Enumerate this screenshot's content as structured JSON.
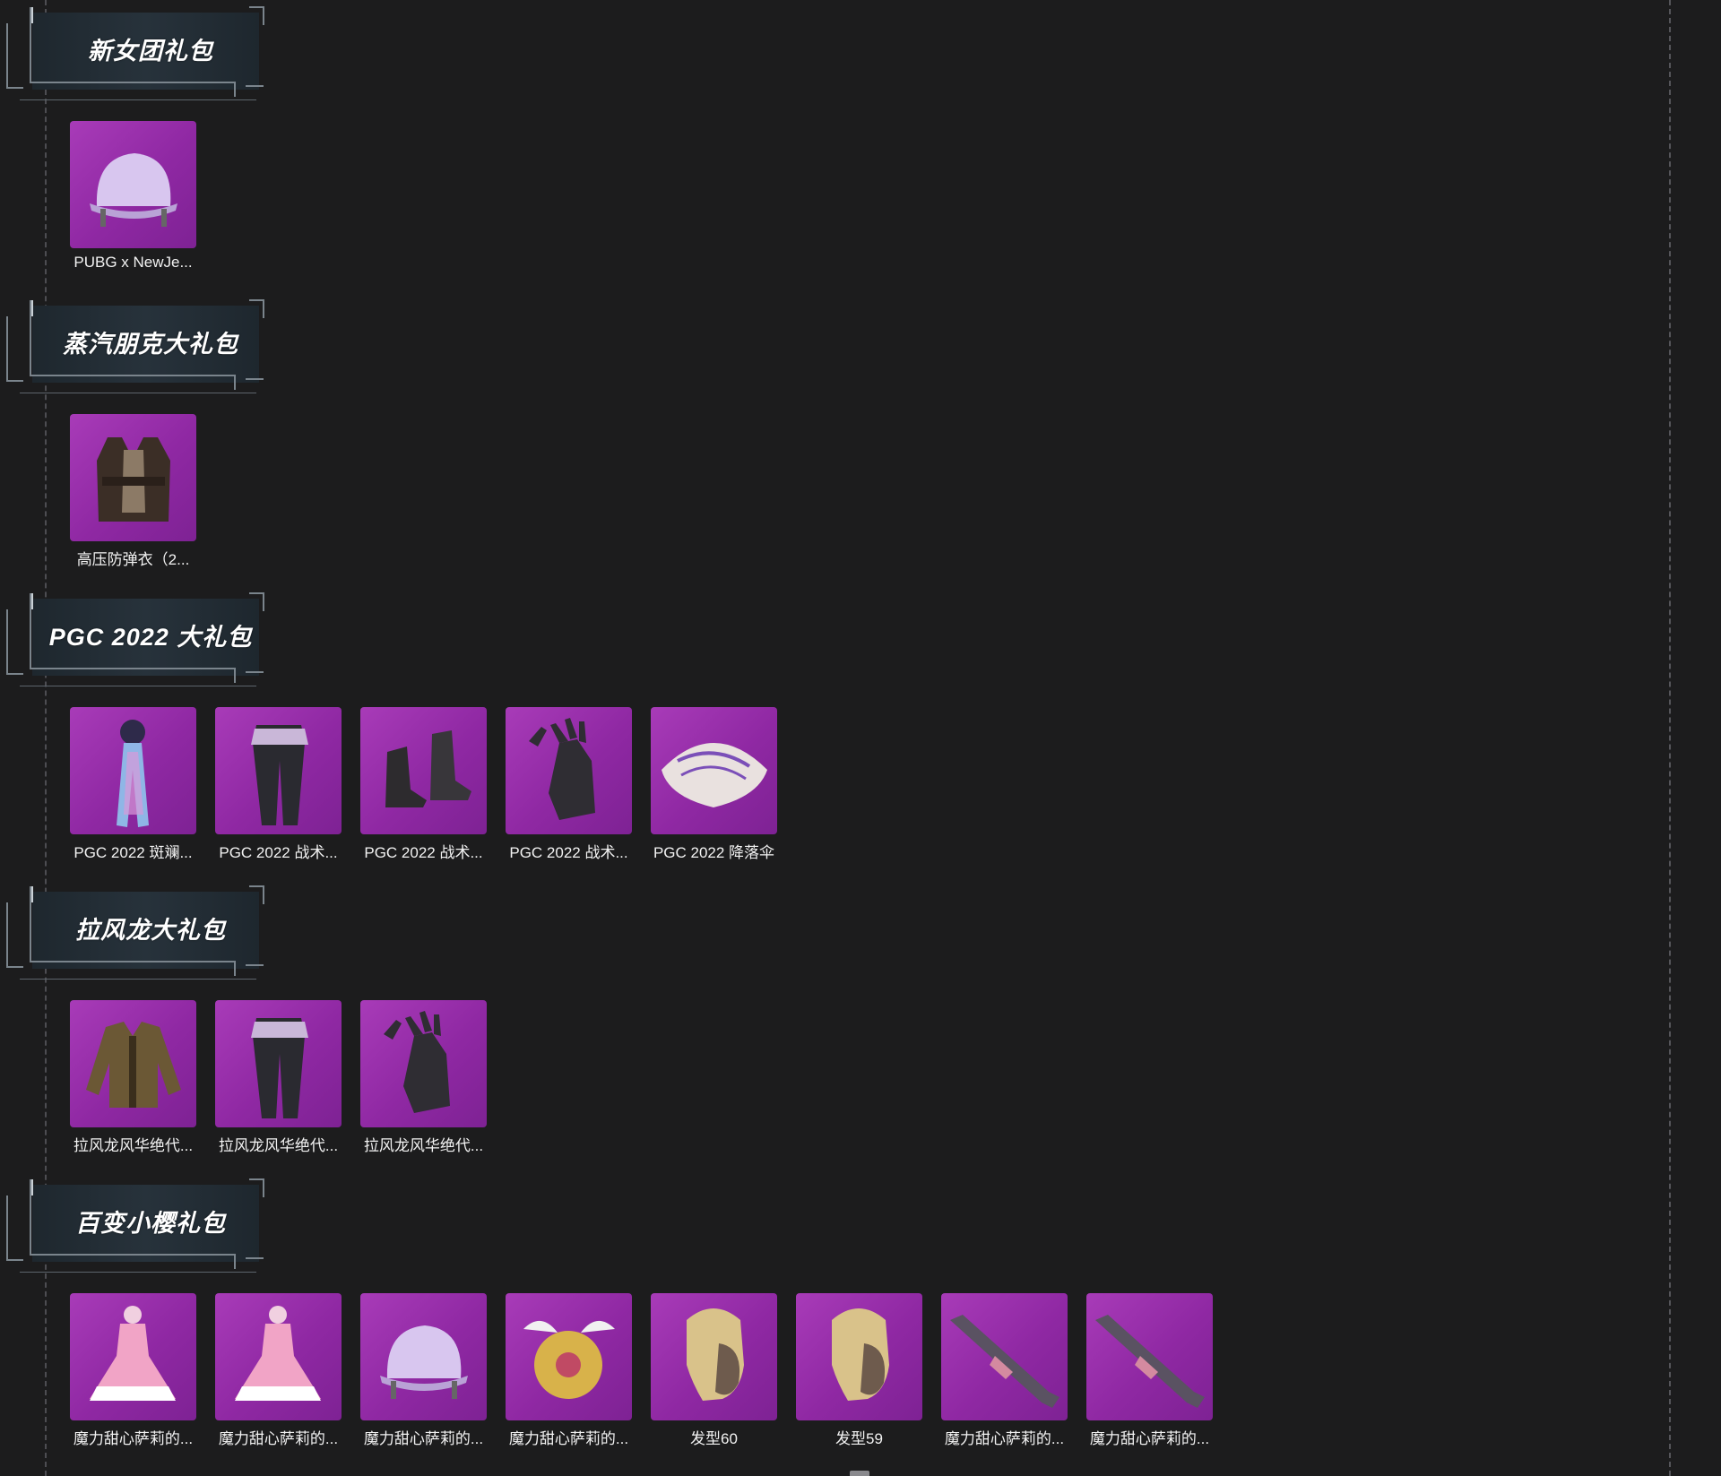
{
  "sections": [
    {
      "title": "新女团礼包",
      "items": [
        {
          "label": "PUBG x NewJe...",
          "icon": "helmet-icon"
        }
      ]
    },
    {
      "title": "蒸汽朋克大礼包",
      "items": [
        {
          "label": "高压防弹衣（2...",
          "icon": "vest-icon"
        }
      ]
    },
    {
      "title": "PGC 2022 大礼包",
      "items": [
        {
          "label": "PGC 2022 斑斓...",
          "icon": "scarf-icon"
        },
        {
          "label": "PGC 2022 战术...",
          "icon": "pants-icon"
        },
        {
          "label": "PGC 2022 战术...",
          "icon": "boots-icon"
        },
        {
          "label": "PGC 2022 战术...",
          "icon": "gloves-icon"
        },
        {
          "label": "PGC 2022 降落伞",
          "icon": "parachute-icon"
        }
      ]
    },
    {
      "title": "拉风龙大礼包",
      "items": [
        {
          "label": "拉风龙风华绝代...",
          "icon": "jacket-icon"
        },
        {
          "label": "拉风龙风华绝代...",
          "icon": "pants-icon"
        },
        {
          "label": "拉风龙风华绝代...",
          "icon": "gloves-icon"
        }
      ]
    },
    {
      "title": "百变小樱礼包",
      "items": [
        {
          "label": "魔力甜心萨莉的...",
          "icon": "dress-icon"
        },
        {
          "label": "魔力甜心萨莉的...",
          "icon": "dress-icon"
        },
        {
          "label": "魔力甜心萨莉的...",
          "icon": "helmet-icon"
        },
        {
          "label": "魔力甜心萨莉的...",
          "icon": "backpack-icon"
        },
        {
          "label": "发型60",
          "icon": "hair-icon"
        },
        {
          "label": "发型59",
          "icon": "hair-icon"
        },
        {
          "label": "魔力甜心萨莉的...",
          "icon": "rifle-icon"
        },
        {
          "label": "魔力甜心萨莉的...",
          "icon": "rifle-icon"
        }
      ]
    }
  ],
  "colors": {
    "background": "#1c1c1d",
    "item_tile": "#9a30ad",
    "banner_panel": "#242e36"
  }
}
